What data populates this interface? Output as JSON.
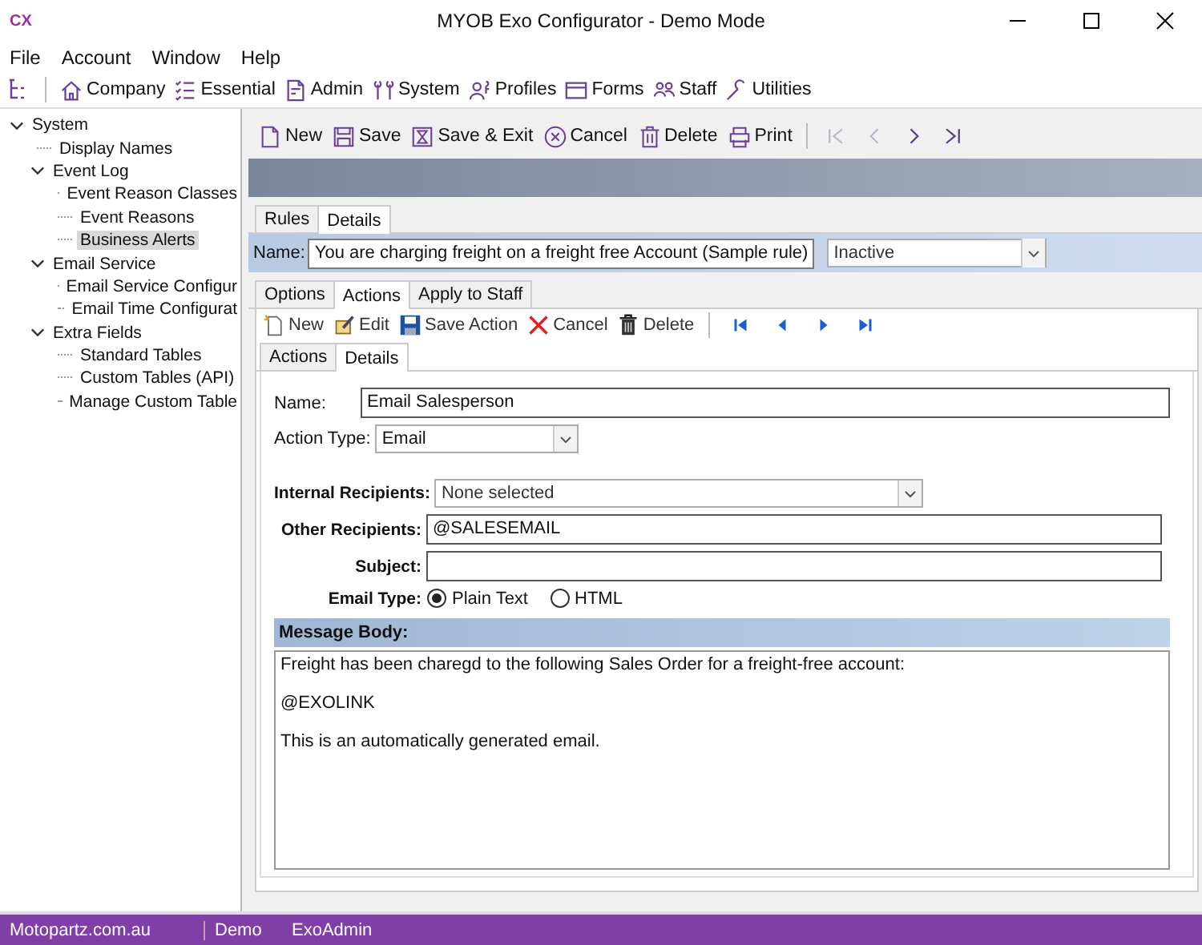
{
  "window": {
    "logo": "CX",
    "title": "MYOB Exo Configurator - Demo Mode"
  },
  "menu": [
    "File",
    "Account",
    "Window",
    "Help"
  ],
  "app_toolbar": [
    "Company",
    "Essential",
    "Admin",
    "System",
    "Profiles",
    "Forms",
    "Staff",
    "Utilities"
  ],
  "sidebar": {
    "items": [
      {
        "label": "System",
        "expanded": true,
        "selected": false,
        "children": [
          {
            "label": "Display Names",
            "selected": false
          },
          {
            "label": "Event Log",
            "expanded": true,
            "selected": false,
            "children": [
              {
                "label": "Event Reason Classes",
                "selected": false
              },
              {
                "label": "Event Reasons",
                "selected": false
              },
              {
                "label": "Business Alerts",
                "selected": true
              }
            ]
          },
          {
            "label": "Email Service",
            "expanded": true,
            "selected": false,
            "children": [
              {
                "label": "Email Service Configur",
                "selected": false
              },
              {
                "label": "Email Time Configurat",
                "selected": false
              }
            ]
          },
          {
            "label": "Extra Fields",
            "expanded": true,
            "selected": false,
            "children": [
              {
                "label": "Standard Tables",
                "selected": false
              },
              {
                "label": "Custom Tables (API)",
                "selected": false
              },
              {
                "label": "Manage Custom Table",
                "selected": false
              }
            ]
          }
        ]
      }
    ]
  },
  "record_toolbar": {
    "buttons": [
      "New",
      "Save",
      "Save & Exit",
      "Cancel",
      "Delete",
      "Print"
    ],
    "nav": [
      {
        "kind": "first",
        "disabled": true
      },
      {
        "kind": "prev",
        "disabled": true
      },
      {
        "kind": "next",
        "disabled": false
      },
      {
        "kind": "last",
        "disabled": false
      }
    ]
  },
  "tabs": [
    {
      "label": "Rules",
      "selected": false
    },
    {
      "label": "Details",
      "selected": true
    }
  ],
  "rule": {
    "name_label": "Name:",
    "name": "You are charging freight on a freight free Account (Sample rule)",
    "status": "Inactive"
  },
  "detail_tabs": [
    {
      "label": "Options",
      "selected": false
    },
    {
      "label": "Actions",
      "selected": true
    },
    {
      "label": "Apply to Staff",
      "selected": false
    }
  ],
  "action_toolbar": {
    "buttons": [
      "New",
      "Edit",
      "Save Action",
      "Cancel",
      "Delete"
    ],
    "nav": [
      {
        "kind": "first",
        "disabled": false
      },
      {
        "kind": "prev",
        "disabled": false
      },
      {
        "kind": "next",
        "disabled": false
      },
      {
        "kind": "last",
        "disabled": false
      }
    ]
  },
  "action_tabs": [
    {
      "label": "Actions",
      "selected": false
    },
    {
      "label": "Details",
      "selected": true
    }
  ],
  "form": {
    "name_label": "Name:",
    "name": "Email Salesperson",
    "action_type_label": "Action Type:",
    "action_type": "Email",
    "internal_label": "Internal Recipients:",
    "internal": "None selected",
    "other_label": "Other Recipients:",
    "other": "@SALESEMAIL",
    "subject_label": "Subject:",
    "email_type_label": "Email Type:",
    "email_types": [
      {
        "label": "Plain Text",
        "selected": true
      },
      {
        "label": "HTML",
        "selected": false
      }
    ],
    "body_label": "Message Body:",
    "body": [
      "Freight has been charegd to the following Sales Order for a freight-free account:",
      "@EXOLINK",
      "This is an automatically generated email."
    ]
  },
  "status_bar": [
    "Motopartz.com.au",
    "Demo",
    "ExoAdmin"
  ]
}
